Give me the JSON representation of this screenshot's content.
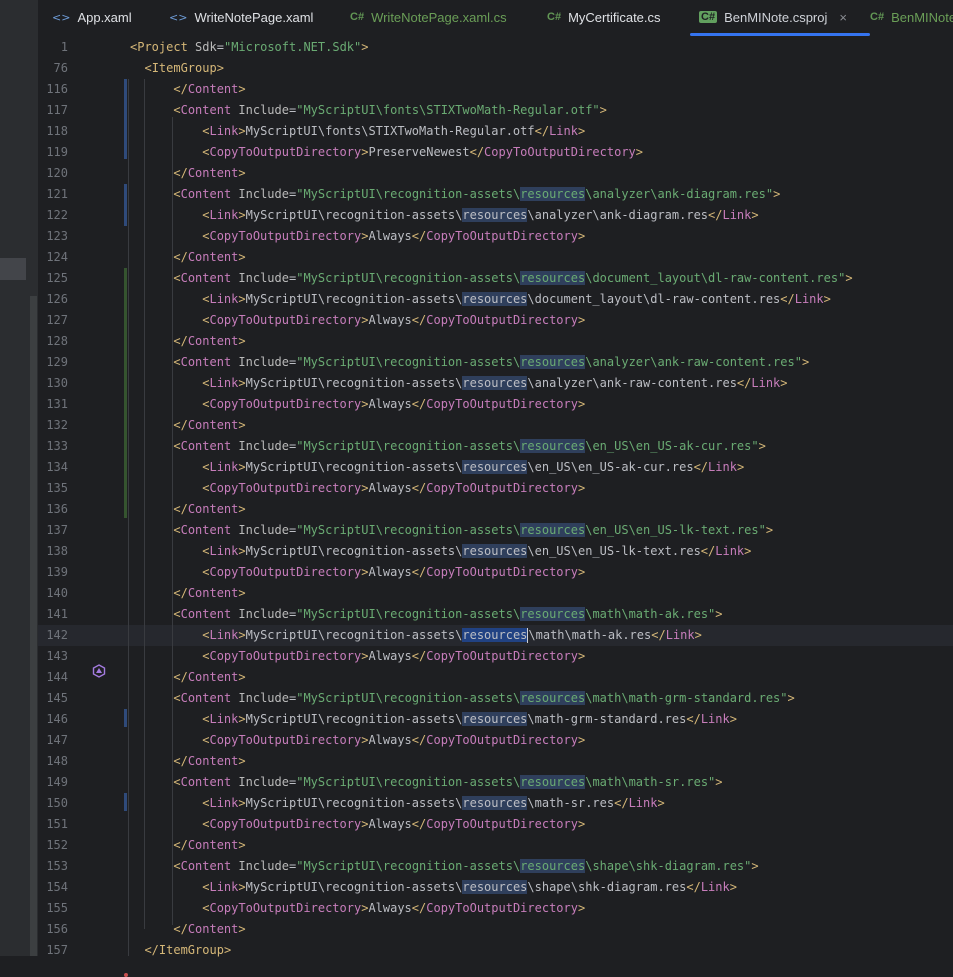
{
  "tabs": [
    {
      "label": "App.xaml",
      "icon": "xaml-file-icon"
    },
    {
      "label": "WriteNotePage.xaml",
      "icon": "xaml-file-icon"
    },
    {
      "label": "WriteNotePage.xaml.cs",
      "icon": "csharp-file-icon"
    },
    {
      "label": "MyCertificate.cs",
      "icon": "csharp-file-icon"
    },
    {
      "label": "BenMINote.csproj",
      "icon": "csproj-file-icon"
    },
    {
      "label": "BenMINote",
      "icon": "csharp-file-icon"
    }
  ],
  "icons": {
    "xaml": "<>",
    "cs": "C#",
    "close": "×"
  },
  "lines": [
    {
      "n": "1",
      "c": "<Project Sdk=\"Microsoft.NET.Sdk\">"
    },
    {
      "n": "76",
      "c": "  <ItemGroup>"
    },
    {
      "n": "116",
      "c": "      </Content>"
    },
    {
      "n": "117",
      "c": "      <Content Include=\"MyScriptUI\\fonts\\STIXTwoMath-Regular.otf\">"
    },
    {
      "n": "118",
      "c": "          <Link>MyScriptUI\\fonts\\STIXTwoMath-Regular.otf</Link>"
    },
    {
      "n": "119",
      "c": "          <CopyToOutputDirectory>PreserveNewest</CopyToOutputDirectory>"
    },
    {
      "n": "120",
      "c": "      </Content>"
    },
    {
      "n": "121",
      "c": "      <Content Include=\"MyScriptUI\\recognition-assets\\resources\\analyzer\\ank-diagram.res\">"
    },
    {
      "n": "122",
      "c": "          <Link>MyScriptUI\\recognition-assets\\resources\\analyzer\\ank-diagram.res</Link>"
    },
    {
      "n": "123",
      "c": "          <CopyToOutputDirectory>Always</CopyToOutputDirectory>"
    },
    {
      "n": "124",
      "c": "      </Content>"
    },
    {
      "n": "125",
      "c": "      <Content Include=\"MyScriptUI\\recognition-assets\\resources\\document_layout\\dl-raw-content.res\">"
    },
    {
      "n": "126",
      "c": "          <Link>MyScriptUI\\recognition-assets\\resources\\document_layout\\dl-raw-content.res</Link>"
    },
    {
      "n": "127",
      "c": "          <CopyToOutputDirectory>Always</CopyToOutputDirectory>"
    },
    {
      "n": "128",
      "c": "      </Content>"
    },
    {
      "n": "129",
      "c": "      <Content Include=\"MyScriptUI\\recognition-assets\\resources\\analyzer\\ank-raw-content.res\">"
    },
    {
      "n": "130",
      "c": "          <Link>MyScriptUI\\recognition-assets\\resources\\analyzer\\ank-raw-content.res</Link>"
    },
    {
      "n": "131",
      "c": "          <CopyToOutputDirectory>Always</CopyToOutputDirectory>"
    },
    {
      "n": "132",
      "c": "      </Content>"
    },
    {
      "n": "133",
      "c": "      <Content Include=\"MyScriptUI\\recognition-assets\\resources\\en_US\\en_US-ak-cur.res\">"
    },
    {
      "n": "134",
      "c": "          <Link>MyScriptUI\\recognition-assets\\resources\\en_US\\en_US-ak-cur.res</Link>"
    },
    {
      "n": "135",
      "c": "          <CopyToOutputDirectory>Always</CopyToOutputDirectory>"
    },
    {
      "n": "136",
      "c": "      </Content>"
    },
    {
      "n": "137",
      "c": "      <Content Include=\"MyScriptUI\\recognition-assets\\resources\\en_US\\en_US-lk-text.res\">"
    },
    {
      "n": "138",
      "c": "          <Link>MyScriptUI\\recognition-assets\\resources\\en_US\\en_US-lk-text.res</Link>"
    },
    {
      "n": "139",
      "c": "          <CopyToOutputDirectory>Always</CopyToOutputDirectory>"
    },
    {
      "n": "140",
      "c": "      </Content>"
    },
    {
      "n": "141",
      "c": "      <Content Include=\"MyScriptUI\\recognition-assets\\resources\\math\\math-ak.res\">"
    },
    {
      "n": "142",
      "c": "          <Link>MyScriptUI\\recognition-assets\\resources\\math\\math-ak.res</Link>"
    },
    {
      "n": "143",
      "c": "          <CopyToOutputDirectory>Always</CopyToOutputDirectory>"
    },
    {
      "n": "144",
      "c": "      </Content>"
    },
    {
      "n": "145",
      "c": "      <Content Include=\"MyScriptUI\\recognition-assets\\resources\\math\\math-grm-standard.res\">"
    },
    {
      "n": "146",
      "c": "          <Link>MyScriptUI\\recognition-assets\\resources\\math-grm-standard.res</Link>"
    },
    {
      "n": "147",
      "c": "          <CopyToOutputDirectory>Always</CopyToOutputDirectory>"
    },
    {
      "n": "148",
      "c": "      </Content>"
    },
    {
      "n": "149",
      "c": "      <Content Include=\"MyScriptUI\\recognition-assets\\resources\\math\\math-sr.res\">"
    },
    {
      "n": "150",
      "c": "          <Link>MyScriptUI\\recognition-assets\\resources\\math-sr.res</Link>"
    },
    {
      "n": "151",
      "c": "          <CopyToOutputDirectory>Always</CopyToOutputDirectory>"
    },
    {
      "n": "152",
      "c": "      </Content>"
    },
    {
      "n": "153",
      "c": "      <Content Include=\"MyScriptUI\\recognition-assets\\resources\\shape\\shk-diagram.res\">"
    },
    {
      "n": "154",
      "c": "          <Link>MyScriptUI\\recognition-assets\\resources\\shape\\shk-diagram.res</Link>"
    },
    {
      "n": "155",
      "c": "          <CopyToOutputDirectory>Always</CopyToOutputDirectory>"
    },
    {
      "n": "156",
      "c": "      </Content>"
    },
    {
      "n": "157",
      "c": "  </ItemGroup>"
    }
  ],
  "caret_line": "142",
  "colors": {
    "accent": "#3574f0",
    "tag": "#d5b778",
    "string": "#6aab73",
    "name": "#c77dbb"
  }
}
